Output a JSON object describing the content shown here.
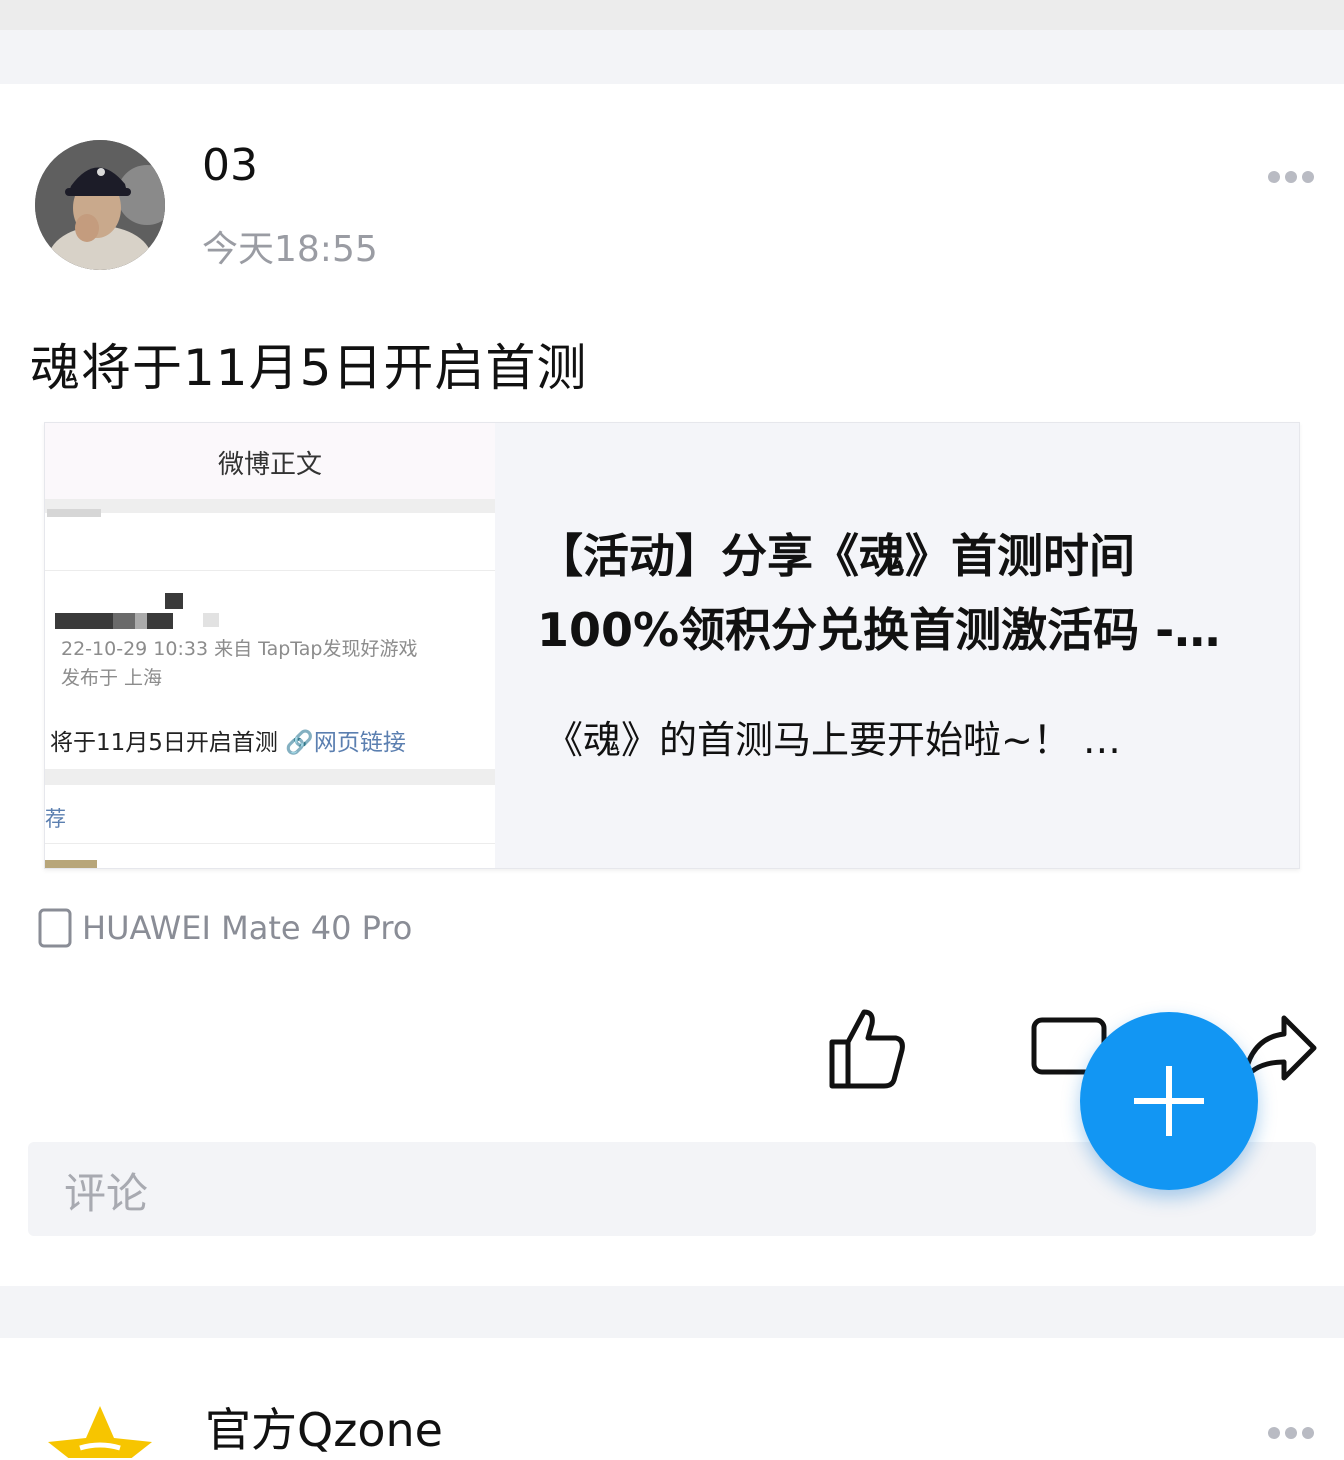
{
  "feed": {
    "post": {
      "username": "03",
      "time": "今天18:55",
      "text": "魂将于11月5日开启首测",
      "link_card": {
        "thumb": {
          "header": "微博正文",
          "meta_line1": "22-10-29 10:33  来自 TapTap发现好游戏",
          "meta_line2": "发布于 上海",
          "main_text": "将于11月5日开启首测 ",
          "link_text": "🔗网页链接",
          "recommend": "荐"
        },
        "title_line1": "【活动】分享《魂》首测时间",
        "title_line2": "100%领积分兑换首测激活码 -…",
        "description": "《魂》的首测马上要开始啦~！ …"
      },
      "device": "HUAWEI Mate 40 Pro",
      "comment_placeholder": "评论"
    },
    "next_post": {
      "username": "官方Qzone"
    }
  },
  "icons": {
    "more": "more-dots-icon",
    "device": "phone-icon",
    "like": "thumbs-up-icon",
    "comment": "comment-icon",
    "share": "share-arrow-icon",
    "fab": "plus-icon"
  },
  "colors": {
    "fab": "#1296f3",
    "secondary_text": "#9a9ca3",
    "link": "#5b7fb0",
    "page_gap": "#f3f4f7"
  }
}
